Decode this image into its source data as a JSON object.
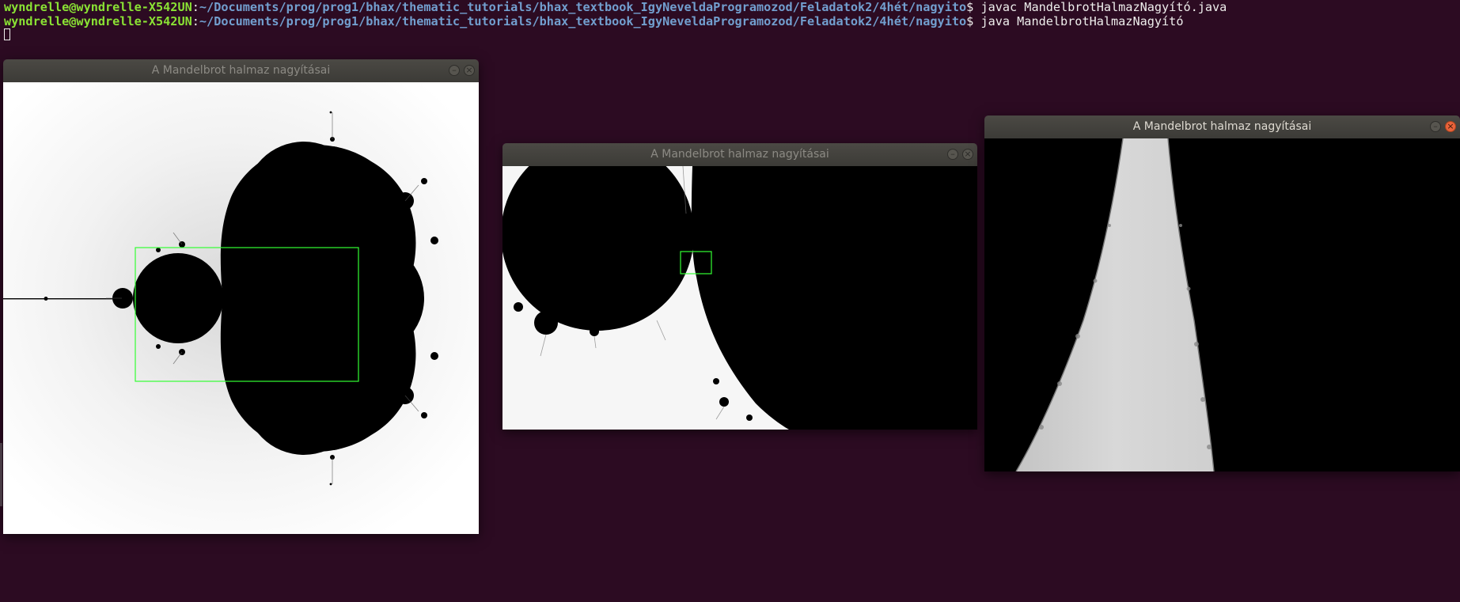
{
  "terminal": {
    "lines": [
      {
        "user_host": "wyndrelle@wyndrelle-X542UN",
        "separator": ":",
        "path": "~/Documents/prog/prog1/bhax/thematic_tutorials/bhax_textbook_IgyNeveldaProgramozod/Feladatok2/4hét/nagyito",
        "prompt": "$ ",
        "command": "javac MandelbrotHalmazNagyító.java"
      },
      {
        "user_host": "wyndrelle@wyndrelle-X542UN",
        "separator": ":",
        "path": "~/Documents/prog/prog1/bhax/thematic_tutorials/bhax_textbook_IgyNeveldaProgramozod/Feladatok2/4hét/nagyito",
        "prompt": "$ ",
        "command": "java MandelbrotHalmazNagyító"
      }
    ]
  },
  "windows": [
    {
      "title": "A Mandelbrot halmaz nagyításai",
      "active": false,
      "minimize_icon": "minimize-icon",
      "close_icon": "close-icon"
    },
    {
      "title": "A Mandelbrot halmaz nagyításai",
      "active": false,
      "minimize_icon": "minimize-icon",
      "close_icon": "close-icon"
    },
    {
      "title": "A Mandelbrot halmaz nagyításai",
      "active": true,
      "minimize_icon": "minimize-icon",
      "close_icon": "close-icon"
    }
  ],
  "colors": {
    "desktop_bg": "#2c0b22",
    "prompt_user": "#8ae234",
    "prompt_path": "#729fcf",
    "zoom_rect": "#33ff33",
    "close_active": "#e9633b"
  }
}
